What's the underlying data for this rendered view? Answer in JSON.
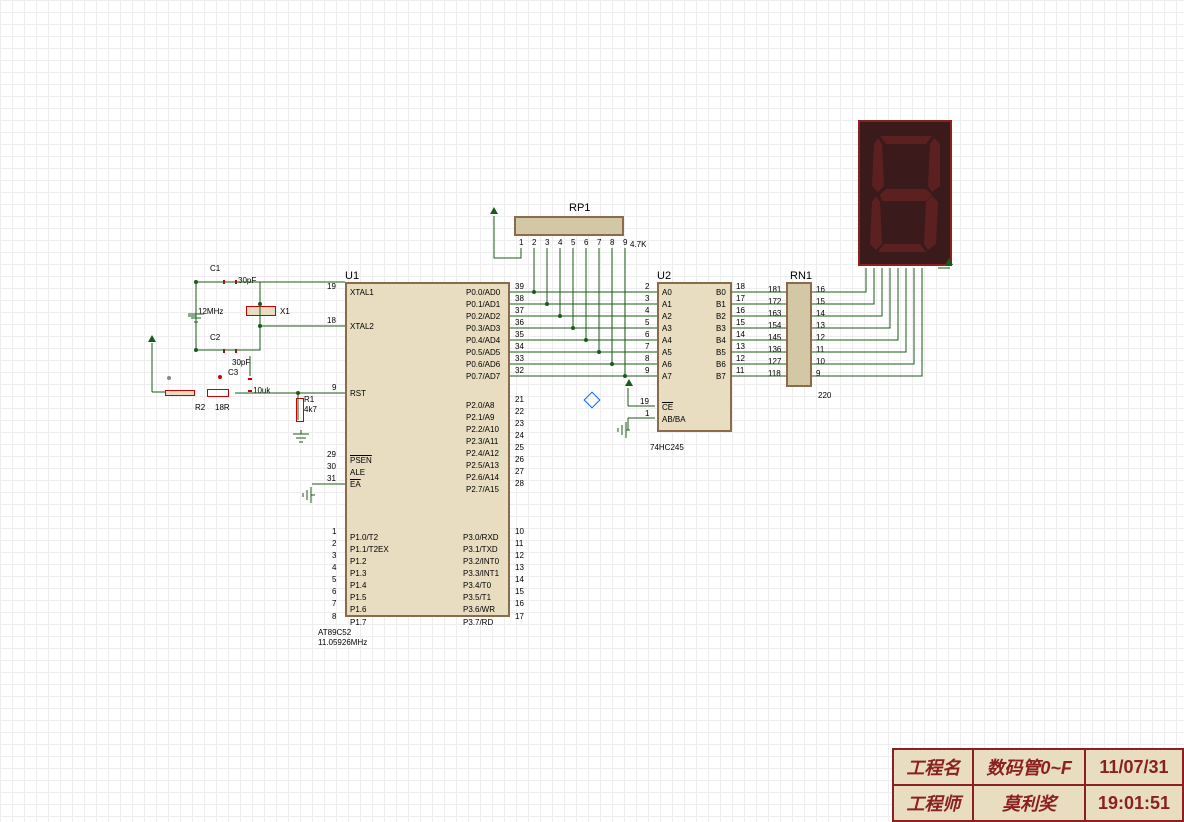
{
  "components": {
    "u1": {
      "ref": "U1",
      "name": "AT89C52",
      "freq": "11.05926MHz",
      "left_pins": {
        "xtal1": "XTAL1",
        "xtal2": "XTAL2",
        "rst": "RST",
        "psen": "PSEN",
        "ale": "ALE",
        "ea": "EA",
        "p10": "P1.0/T2",
        "p11": "P1.1/T2EX",
        "p12": "P1.2",
        "p13": "P1.3",
        "p14": "P1.4",
        "p15": "P1.5",
        "p16": "P1.6",
        "p17": "P1.7"
      },
      "left_nums": {
        "xtal1": "19",
        "xtal2": "18",
        "rst": "9",
        "psen": "29",
        "ale": "30",
        "ea": "31",
        "p10": "1",
        "p11": "2",
        "p12": "3",
        "p13": "4",
        "p14": "5",
        "p15": "6",
        "p16": "7",
        "p17": "8"
      },
      "right_pins": {
        "p00": "P0.0/AD0",
        "p01": "P0.1/AD1",
        "p02": "P0.2/AD2",
        "p03": "P0.3/AD3",
        "p04": "P0.4/AD4",
        "p05": "P0.5/AD5",
        "p06": "P0.6/AD6",
        "p07": "P0.7/AD7",
        "p20": "P2.0/A8",
        "p21": "P2.1/A9",
        "p22": "P2.2/A10",
        "p23": "P2.3/A11",
        "p24": "P2.4/A12",
        "p25": "P2.5/A13",
        "p26": "P2.6/A14",
        "p27": "P2.7/A15",
        "p30": "P3.0/RXD",
        "p31": "P3.1/TXD",
        "p32": "P3.2/INT0",
        "p33": "P3.3/INT1",
        "p34": "P3.4/T0",
        "p35": "P3.5/T1",
        "p36": "P3.6/WR",
        "p37": "P3.7/RD"
      },
      "right_nums": {
        "p00": "39",
        "p01": "38",
        "p02": "37",
        "p03": "36",
        "p04": "35",
        "p05": "34",
        "p06": "33",
        "p07": "32",
        "p20": "21",
        "p21": "22",
        "p22": "23",
        "p23": "24",
        "p24": "25",
        "p25": "26",
        "p26": "27",
        "p27": "28",
        "p30": "10",
        "p31": "11",
        "p32": "12",
        "p33": "13",
        "p34": "14",
        "p35": "15",
        "p36": "16",
        "p37": "17"
      }
    },
    "u2": {
      "ref": "U2",
      "name": "74HC245",
      "left": {
        "a0": "A0",
        "a1": "A1",
        "a2": "A2",
        "a3": "A3",
        "a4": "A4",
        "a5": "A5",
        "a6": "A6",
        "a7": "A7",
        "ce": "CE",
        "ab": "AB/BA"
      },
      "left_nums": {
        "a0": "2",
        "a1": "3",
        "a2": "4",
        "a3": "5",
        "a4": "6",
        "a5": "7",
        "a6": "8",
        "a7": "9",
        "ce": "19",
        "ab": "1"
      },
      "right": {
        "b0": "B0",
        "b1": "B1",
        "b2": "B2",
        "b3": "B3",
        "b4": "B4",
        "b5": "B5",
        "b6": "B6",
        "b7": "B7"
      },
      "right_nums": {
        "b0": "18",
        "b1": "17",
        "b2": "16",
        "b3": "15",
        "b4": "14",
        "b5": "13",
        "b6": "12",
        "b7": "11"
      }
    },
    "rp1": {
      "ref": "RP1",
      "val": "4.7K",
      "pins": [
        "1",
        "2",
        "3",
        "4",
        "5",
        "6",
        "7",
        "8",
        "9"
      ]
    },
    "rn1": {
      "ref": "RN1",
      "val": "220",
      "left_nums": [
        "1",
        "2",
        "3",
        "4",
        "5",
        "6",
        "7",
        "8"
      ],
      "right_nums": [
        "16",
        "15",
        "14",
        "13",
        "12",
        "11",
        "10",
        "9"
      ],
      "left_text": [
        "18",
        "17",
        "16",
        "15",
        "14",
        "13",
        "12",
        "11"
      ]
    },
    "c1": {
      "ref": "C1",
      "val": "30pF"
    },
    "c2": {
      "ref": "C2",
      "val": "30pF"
    },
    "c3": {
      "ref": "C3",
      "val": "10uk"
    },
    "x1": {
      "ref": "X1",
      "val": "12MHz"
    },
    "r1": {
      "ref": "R1",
      "val": "4k7"
    },
    "r2": {
      "ref": "R2",
      "val": "18R"
    }
  },
  "title_block": {
    "proj_label": "工程名",
    "proj_name": "数码管0~F",
    "date": "11/07/31",
    "eng_label": "工程师",
    "eng_name": "莫利奖",
    "time": "19:01:51"
  }
}
